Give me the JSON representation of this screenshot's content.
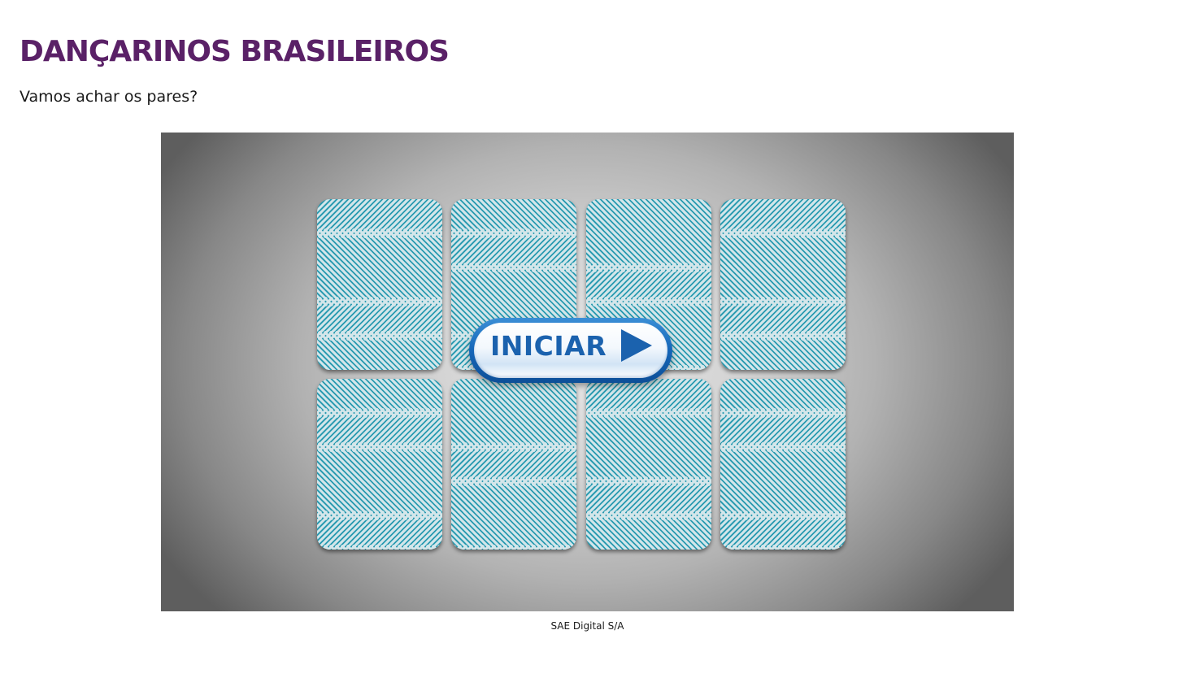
{
  "page": {
    "title": "DANÇARINOS BRASILEIROS",
    "subtitle": "Vamos achar os pares?"
  },
  "game": {
    "start_button_label": "INICIAR",
    "start_icon": "play-icon",
    "card_count": 8,
    "card_back_colors": {
      "base": "#2a9fb6",
      "stripe": "#e2f1f4"
    }
  },
  "credit": "SAE Digital S/A"
}
